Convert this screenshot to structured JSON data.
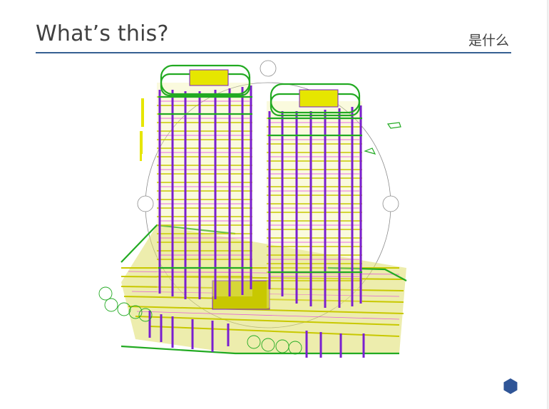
{
  "slide": {
    "title": "What’s this?",
    "subtitle": "是什么"
  },
  "figure": {
    "kind": "3D structural model of twin high-rise towers on a podium"
  },
  "colors": {
    "rule": "#365f91",
    "hexagon": "#2f5597",
    "text": "#404040"
  },
  "icons": {
    "corner_marker": "hexagon-icon"
  }
}
